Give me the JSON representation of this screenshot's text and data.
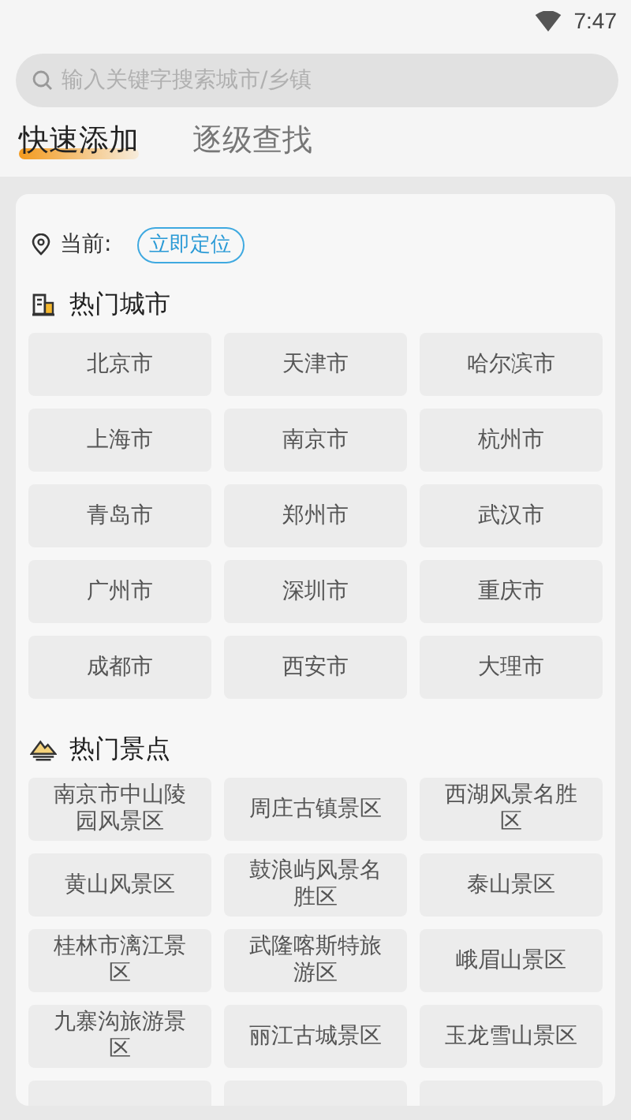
{
  "status_bar": {
    "time": "7:47"
  },
  "search": {
    "placeholder": "输入关键字搜索城市/乡镇"
  },
  "tabs": [
    {
      "label": "快速添加",
      "selected": true
    },
    {
      "label": "逐级查找",
      "selected": false
    }
  ],
  "location": {
    "label": "当前:",
    "button": "立即定位"
  },
  "sections": [
    {
      "kind": "city",
      "title": "热门城市",
      "items": [
        "北京市",
        "天津市",
        "哈尔滨市",
        "上海市",
        "南京市",
        "杭州市",
        "青岛市",
        "郑州市",
        "武汉市",
        "广州市",
        "深圳市",
        "重庆市",
        "成都市",
        "西安市",
        "大理市"
      ]
    },
    {
      "kind": "scenic",
      "title": "热门景点",
      "items": [
        "南京市中山陵园风景区",
        "周庄古镇景区",
        "西湖风景名胜区",
        "黄山风景区",
        "鼓浪屿风景名胜区",
        "泰山景区",
        "桂林市漓江景区",
        "武隆喀斯特旅游区",
        "峨眉山景区",
        "九寨沟旅游景区",
        "丽江古城景区",
        "玉龙雪山景区"
      ]
    }
  ]
}
